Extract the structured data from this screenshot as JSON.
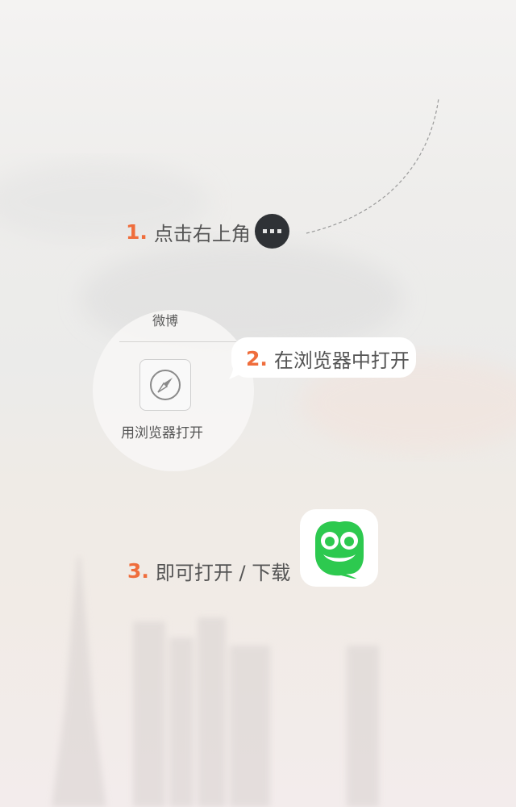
{
  "steps": [
    {
      "number": "1.",
      "text": "点击右上角"
    },
    {
      "number": "2.",
      "text": "在浏览器中打开"
    },
    {
      "number": "3.",
      "text": "即可打开 / 下载"
    }
  ],
  "menu": {
    "title": "微博",
    "browser_option": "用浏览器打开"
  },
  "colors": {
    "accent": "#ef6d3c",
    "text": "#555555",
    "app_green": "#2dc94f",
    "more_button": "#2f3236"
  },
  "icons": {
    "more": "more-dots-icon",
    "browser": "compass-icon",
    "app": "owl-app-icon"
  }
}
